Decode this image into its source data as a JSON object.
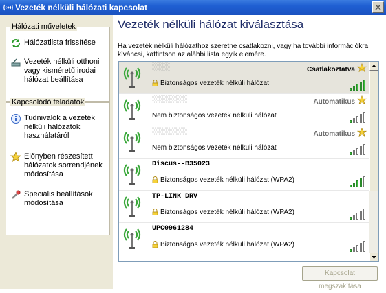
{
  "window": {
    "title": "Vezeték nélküli hálózati kapcsolat"
  },
  "left": {
    "group1": {
      "title": "Hálózati műveletek",
      "items": [
        {
          "label": "Hálózatlista frissítése",
          "icon": "refresh-icon"
        },
        {
          "label": "Vezeték nélküli otthoni vagy kisméretű irodai hálózat beállítása",
          "icon": "setup-icon"
        }
      ]
    },
    "group2": {
      "title": "Kapcsolódó feladatok",
      "items": [
        {
          "label": "Tudnivalók a vezeték nélküli hálózatok használatáról",
          "icon": "info-icon"
        },
        {
          "label": "Előnyben részesített hálózatok sorrendjének módosítása",
          "icon": "star-icon"
        },
        {
          "label": "Speciális beállítások módosítása",
          "icon": "settings-icon"
        }
      ]
    }
  },
  "main": {
    "title": "Vezeték nélküli hálózat kiválasztása",
    "description": "Ha vezeték nélküli hálózathoz szeretne csatlakozni, vagy ha további információkra kíváncsi, kattintson az alábbi lista egyik elemére.",
    "disconnect_button": "Kapcsolat megszakítása"
  },
  "networks": [
    {
      "ssid": "░░░░░",
      "ssid_obscured": true,
      "status": "Csatlakoztatva",
      "starred": true,
      "security": "Biztonságos vezeték nélküli hálózat",
      "secured": true,
      "signal": 5,
      "selected": true
    },
    {
      "ssid": "░░░░░░░░░░",
      "ssid_obscured": true,
      "status": "Automatikus",
      "starred": true,
      "security": "Nem biztonságos vezeték nélküli hálózat",
      "secured": false,
      "signal": 1
    },
    {
      "ssid": "░░░░░░░░░░",
      "ssid_obscured": true,
      "status": "Automatikus",
      "starred": true,
      "security": "Nem biztonságos vezeték nélküli hálózat",
      "secured": false,
      "signal": 1
    },
    {
      "ssid": "Discus--B35023",
      "status": "",
      "starred": false,
      "security": "Biztonságos vezeték nélküli hálózat (WPA2)",
      "secured": true,
      "signal": 4
    },
    {
      "ssid": "TP-LINK_DRV",
      "status": "",
      "starred": false,
      "security": "Biztonságos vezeték nélküli hálózat (WPA2)",
      "secured": true,
      "signal": 1
    },
    {
      "ssid": "UPC0961284",
      "status": "",
      "starred": false,
      "security": "Biztonságos vezeték nélküli hálózat (WPA2)",
      "secured": true,
      "signal": 1
    }
  ]
}
